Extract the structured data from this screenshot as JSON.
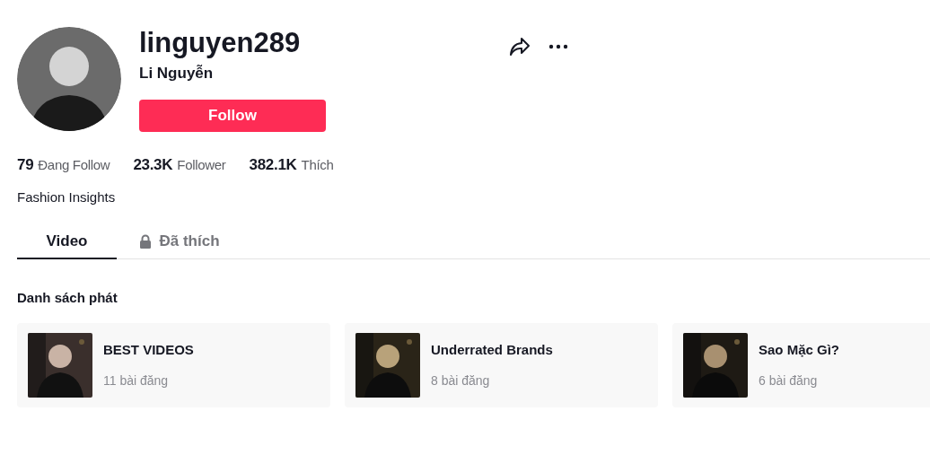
{
  "profile": {
    "username": "linguyen289",
    "display_name": "Li Nguyễn",
    "follow_button": "Follow",
    "bio": "Fashion Insights"
  },
  "stats": [
    {
      "count": "79",
      "unit": "Đang Follow"
    },
    {
      "count": "23.3K",
      "unit": "Follower"
    },
    {
      "count": "382.1K",
      "unit": "Thích"
    }
  ],
  "tabs": [
    {
      "label": "Video",
      "selected": true,
      "locked": false
    },
    {
      "label": "Đã thích",
      "selected": false,
      "locked": true
    }
  ],
  "playlists": {
    "title": "Danh sách phát",
    "items": [
      {
        "name": "BEST VIDEOS",
        "count": "11 bài đăng"
      },
      {
        "name": "Underrated Brands",
        "count": "8 bài đăng"
      },
      {
        "name": "Sao Mặc Gì?",
        "count": "6 bài đăng"
      }
    ]
  }
}
